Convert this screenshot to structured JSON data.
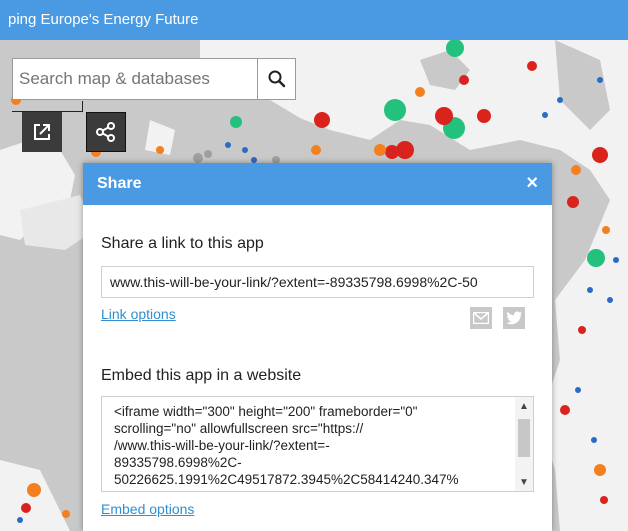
{
  "app": {
    "title": "ping Europe's Energy Future"
  },
  "search": {
    "placeholder": "Search map & databases",
    "button_icon": "search-icon"
  },
  "map_tools": {
    "popout_icon": "popout-icon",
    "share_icon": "share-icon"
  },
  "share_dialog": {
    "title": "Share",
    "close_label": "×",
    "link_section_title": "Share a link to this app",
    "link_value": "www.this-will-be-your-link/?extent=-89335798.6998%2C-50",
    "link_options_label": "Link options",
    "social_icons": [
      "email-icon",
      "twitter-icon"
    ],
    "embed_section_title": "Embed this app in a website",
    "embed_code": "<iframe width=\"300\" height=\"200\" frameborder=\"0\"\nscrolling=\"no\" allowfullscreen src=\"https://\n/www.this-will-be-your-link/?extent=-\n89335798.6998%2C-\n50226625.1991%2C49517872.3945%2C58414240.347%",
    "embed_options_label": "Embed options"
  },
  "colors": {
    "header": "#4a9ae3",
    "link": "#2f8fd0",
    "map_land": "#f2f2f2",
    "map_water": "#c9c9c9",
    "marker_orange": "#f47f1f",
    "marker_red": "#d9231c",
    "marker_blue": "#2b6bc3",
    "marker_green": "#24c07e",
    "marker_gray": "#a0a0a0"
  }
}
